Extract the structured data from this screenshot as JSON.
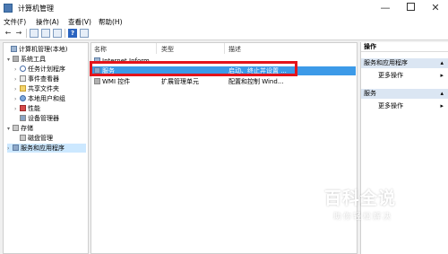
{
  "window": {
    "title": "计算机管理",
    "min_glyph": "—",
    "close_glyph": "✕"
  },
  "menu": [
    "文件(F)",
    "操作(A)",
    "查看(V)",
    "帮助(H)"
  ],
  "toolbar": {
    "back": "←",
    "forward": "→",
    "help": "?"
  },
  "tree": [
    {
      "label": "计算机管理(本地)",
      "arrow": ""
    },
    {
      "label": "系统工具",
      "arrow": "▾"
    },
    {
      "label": "任务计划程序",
      "arrow": "›"
    },
    {
      "label": "事件查看器",
      "arrow": "›"
    },
    {
      "label": "共享文件夹",
      "arrow": "›"
    },
    {
      "label": "本地用户和组",
      "arrow": "›"
    },
    {
      "label": "性能",
      "arrow": "›"
    },
    {
      "label": "设备管理器",
      "arrow": ""
    },
    {
      "label": "存储",
      "arrow": "▾"
    },
    {
      "label": "磁盘管理",
      "arrow": ""
    },
    {
      "label": "服务和应用程序",
      "arrow": "›"
    }
  ],
  "list": {
    "columns": [
      "名称",
      "类型",
      "描述"
    ],
    "rows": [
      {
        "name": "Internet Inform...",
        "type": "",
        "desc": ""
      },
      {
        "name": "服务",
        "type": "",
        "desc": "启动、终止并设置 ..."
      },
      {
        "name": "WMI 控件",
        "type": "扩展管理单元",
        "desc": "配置和控制 Wind..."
      }
    ]
  },
  "actions": {
    "header": "操作",
    "sections": [
      {
        "title": "服务和应用程序",
        "item": "更多操作"
      },
      {
        "title": "服务",
        "item": "更多操作"
      }
    ]
  },
  "watermark": {
    "text": "百科全说",
    "sub": "助你轻松解决"
  }
}
